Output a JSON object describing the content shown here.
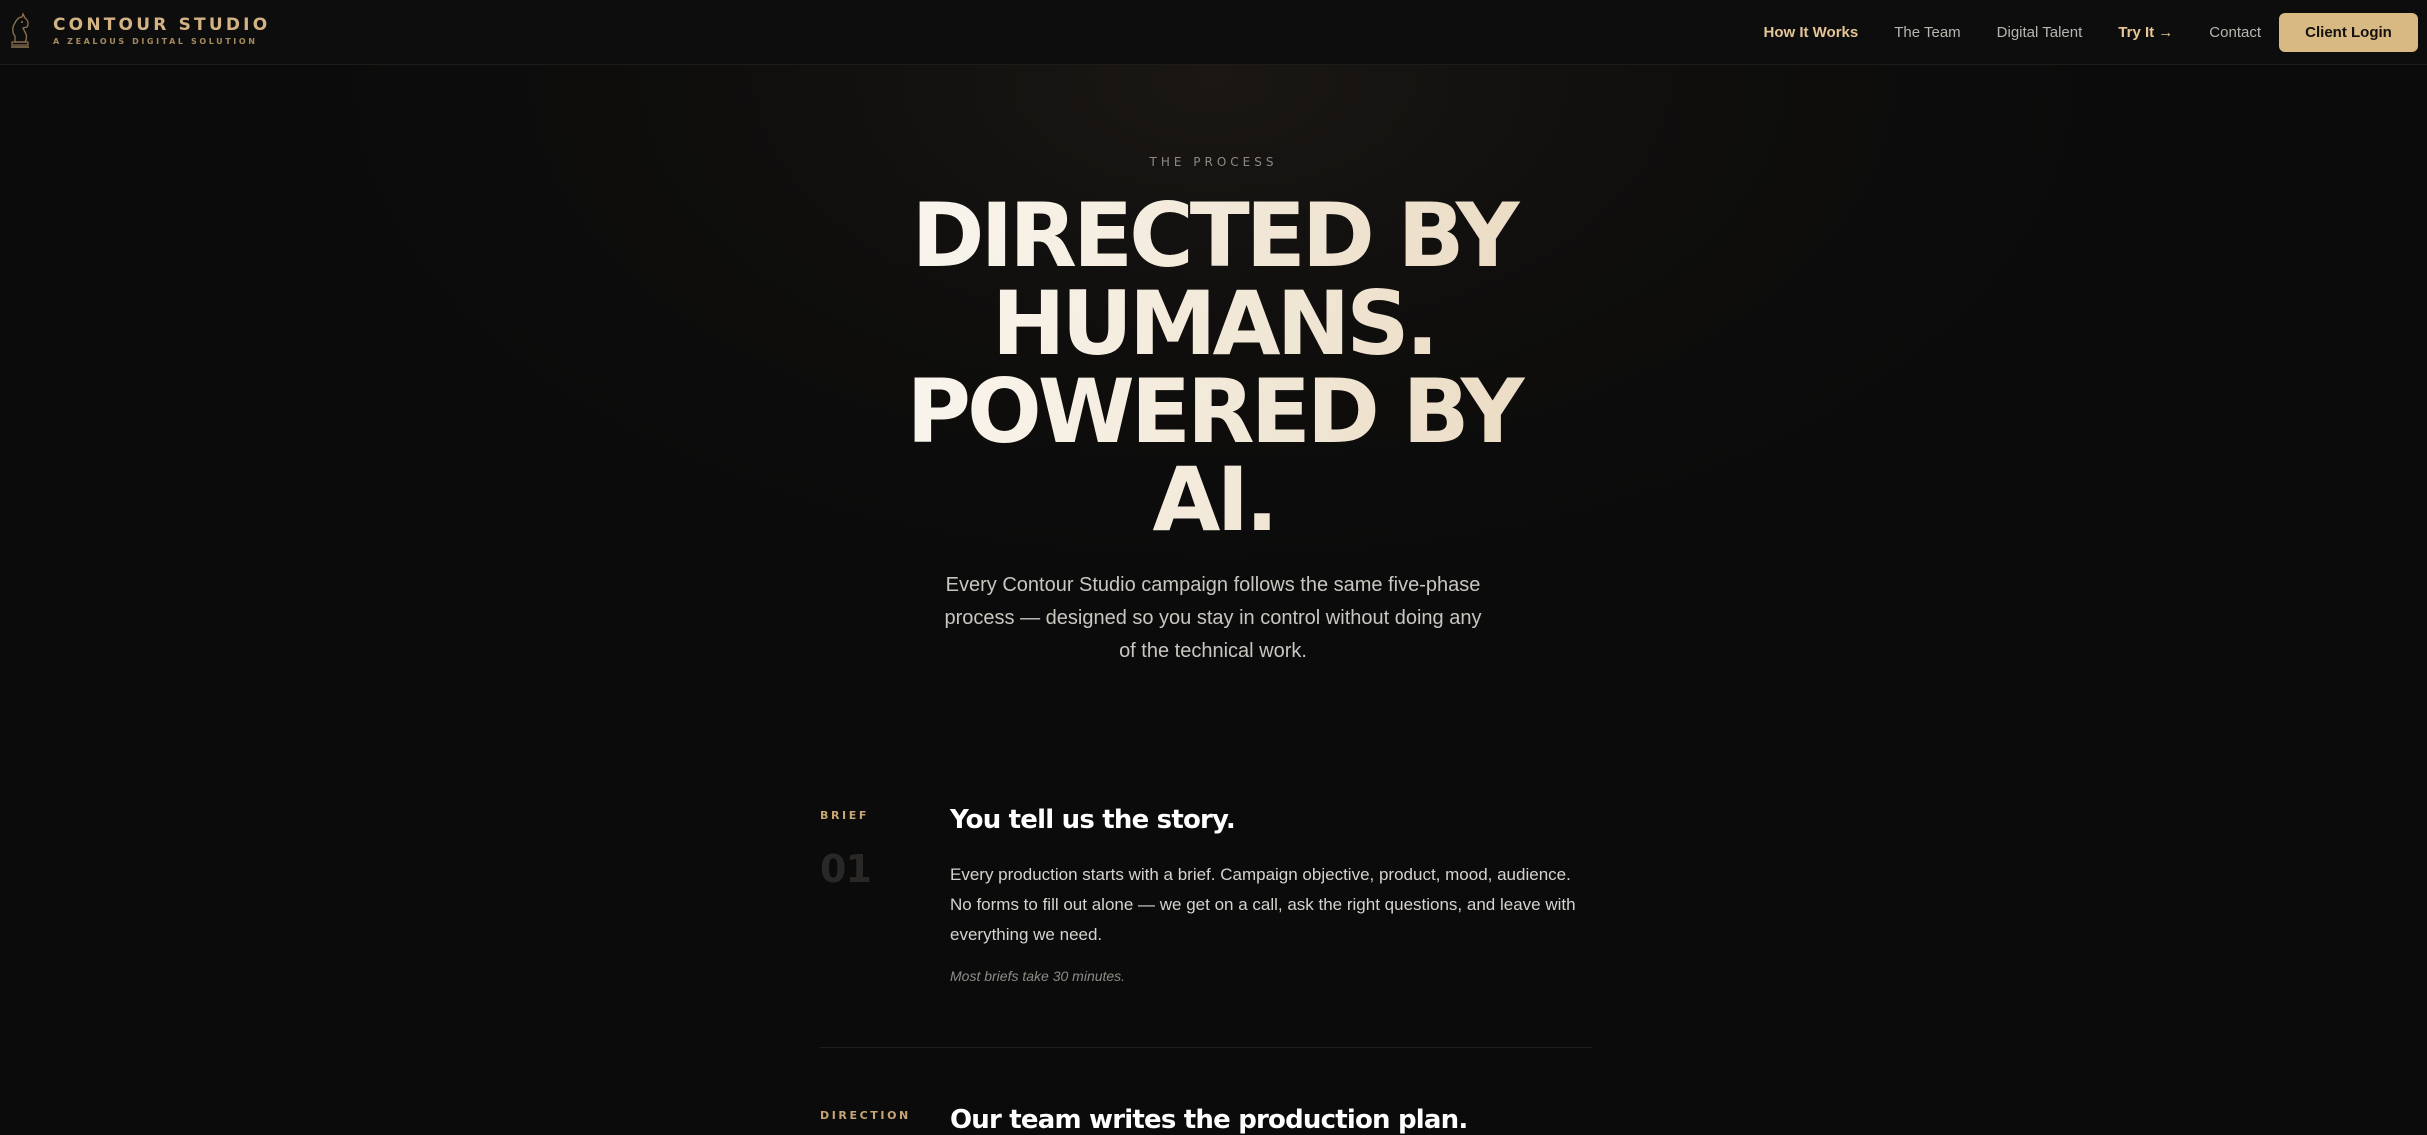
{
  "nav": {
    "brand_name": "CONTOUR STUDIO",
    "brand_tagline": "A ZEALOUS DIGITAL SOLUTION",
    "links": {
      "how": "How It Works",
      "team": "The Team",
      "talent": "Digital Talent",
      "try": "Try It →",
      "contact": "Contact"
    },
    "login": "Client Login"
  },
  "hero": {
    "eyebrow": "THE PROCESS",
    "headline": [
      "DIRECTED BY",
      "HUMANS.",
      "POWERED BY",
      "AI."
    ],
    "lede": "Every Contour Studio campaign follows the same five-phase process — designed so you stay in control without doing any of the technical work."
  },
  "steps": [
    {
      "label": "BRIEF",
      "number": "01",
      "title": "You tell us the story.",
      "body": "Every production starts with a brief. Campaign objective, product, mood, audience. No forms to fill out alone — we get on a call, ask the right questions, and leave with everything we need.",
      "note": "Most briefs take 30 minutes."
    },
    {
      "label": "DIRECTION",
      "title": "Our team writes the production plan."
    }
  ],
  "colors": {
    "accent": "#d8b883",
    "background": "#0c0c0c"
  }
}
